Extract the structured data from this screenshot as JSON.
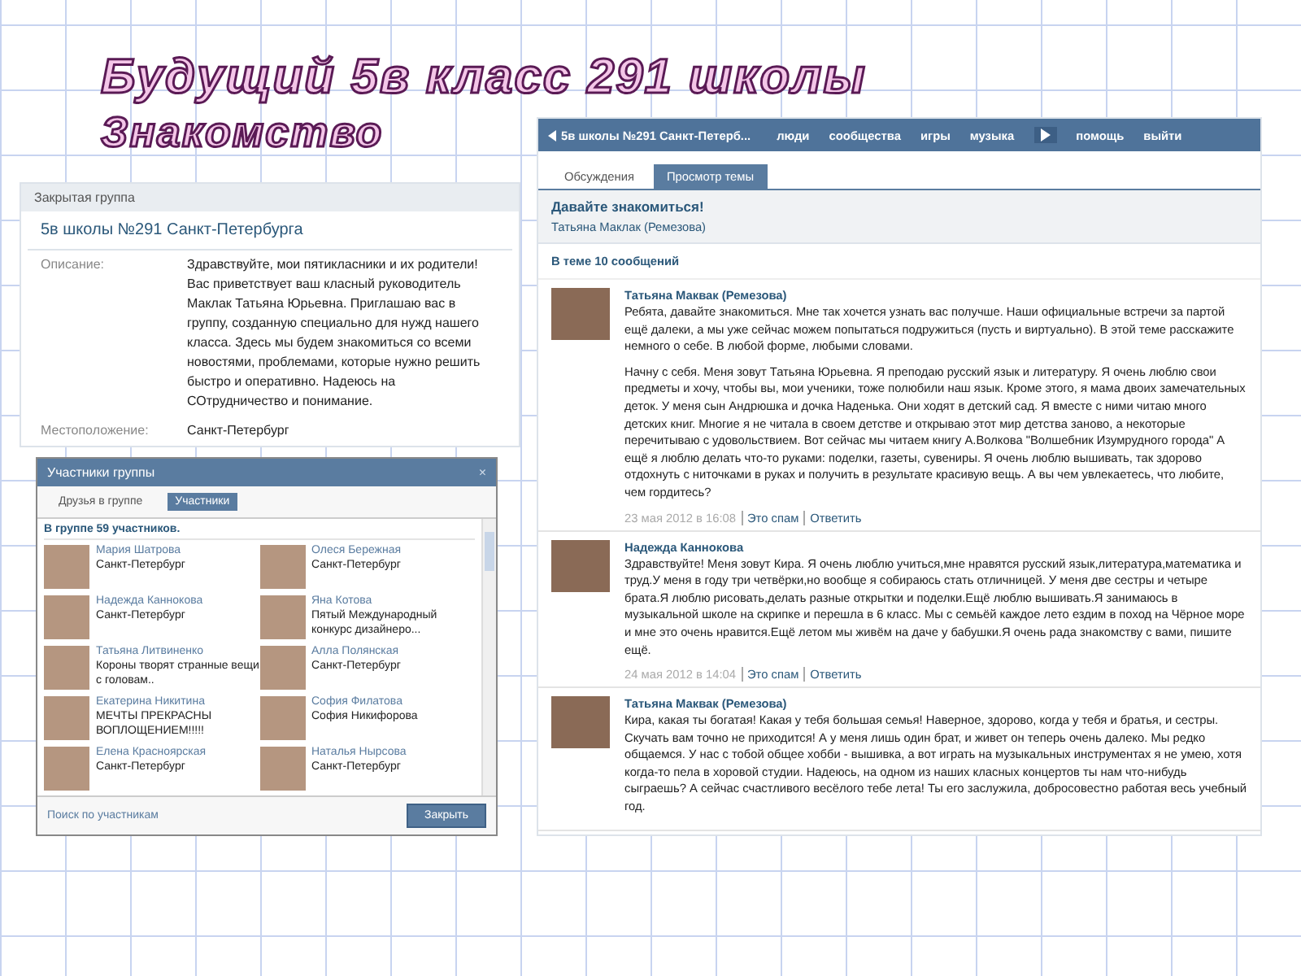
{
  "slide": {
    "title": "Будущий 5в класс 291 школы",
    "subtitle": "Знакомство"
  },
  "group_card": {
    "header": "Закрытая группа",
    "name": "5в школы №291 Санкт-Петербурга",
    "fields": [
      {
        "label": "Описание:",
        "value": "Здравствуйте, мои пятикласники и их родители! Вас приветствует ваш класный руководитель Маклак Татьяна Юрьевна. Приглашаю вас в группу, созданную специально для нужд нашего класса. Здесь мы будем знакомиться со всеми новостями, проблемами, которые нужно решить быстро и оперативно. Надеюсь на СОтрудничество и понимание."
      },
      {
        "label": "Местоположение:",
        "value": "Санкт-Петербург"
      }
    ]
  },
  "members_dialog": {
    "title": "Участники группы",
    "close": "×",
    "tabs": [
      {
        "label": "Друзья в группе",
        "selected": false
      },
      {
        "label": "Участники",
        "selected": true
      }
    ],
    "count": "В группе 59 участников.",
    "members": [
      {
        "name": "Мария Шатрова",
        "status": "Санкт-Петербург"
      },
      {
        "name": "Олеся Бережная",
        "status": "Санкт-Петербург"
      },
      {
        "name": "Надежда Каннокова",
        "status": "Санкт-Петербург"
      },
      {
        "name": "Яна Котова",
        "status": "Пятый Международный конкурс дизайнеро..."
      },
      {
        "name": "Татьяна Литвиненко",
        "status": "Короны творят странные вещи с головам.."
      },
      {
        "name": "Алла Полянская",
        "status": "Санкт-Петербург"
      },
      {
        "name": "Екатерина Никитина",
        "status": "МЕЧТЫ ПРЕКРАСНЫ ВОПЛОЩЕНИЕМ!!!!!"
      },
      {
        "name": "София Филатова",
        "status": "София Никифорова"
      },
      {
        "name": "Елена Красноярская",
        "status": "Санкт-Петербург"
      },
      {
        "name": "Наталья Нырсова",
        "status": "Санкт-Петербург"
      }
    ],
    "search_link": "Поиск по участникам",
    "close_button": "Закрыть"
  },
  "forum": {
    "nav": {
      "back": "5в школы №291 Санкт-Петерб...",
      "items": [
        "люди",
        "сообщества",
        "игры",
        "музыка"
      ],
      "items_after": [
        "помощь",
        "выйти"
      ]
    },
    "tabs": [
      {
        "label": "Обсуждения",
        "selected": false
      },
      {
        "label": "Просмотр темы",
        "selected": true
      }
    ],
    "topic": {
      "title": "Давайте знакомиться!",
      "author": "Татьяна Маклак (Ремезова)"
    },
    "count": "В теме 10 сообщений",
    "posts": [
      {
        "author": "Татьяна Маквак (Ремезова)",
        "paragraphs": [
          "Ребята, давайте знакомиться. Мне так хочется узнать вас получше. Наши официальные встречи за партой ещё далеки, а мы уже сейчас можем попытаться подружиться (пусть и виртуально). В этой теме расскажите немного о себе. В любой форме, любыми словами.",
          "Начну с себя. Меня зовут Татьяна Юрьевна. Я преподаю русский язык и литературу. Я очень люблю свои предметы и хочу, чтобы вы, мои ученики, тоже полюбили наш язык. Кроме этого, я мама двоих замечательных деток. У меня сын Андрюшка и дочка Наденька. Они ходят в детский сад. Я вместе с ними читаю много детских книг. Многие я не читала в своем детстве и открываю этот мир детства заново, а некоторые перечитываю с удовольствием. Вот сейчас мы читаем книгу А.Волкова \"Волшебник Изумрудного города\" А ещё я люблю делать что-то руками: поделки, газеты, сувениры. Я очень люблю вышивать, так здорово отдохнуть с ниточками в руках и получить в результате красивую вещь. А вы чем увлекаетесь, что любите, чем гордитесь?"
        ],
        "date": "23 мая 2012 в 16:08",
        "actions": [
          "Это спам",
          "Ответить"
        ]
      },
      {
        "author": "Надежда Каннокова",
        "paragraphs": [
          "Здравствуйте! Меня зовут Кира. Я очень люблю учиться,мне нравятся русский язык,литература,математика и труд.У меня в году три четвёрки,но вообще я собираюсь стать отличницей. У меня две сестры и четыре брата.Я люблю рисовать,делать разные открытки и поделки.Ещё люблю вышивать.Я занимаюсь в музыкальной школе на скрипке и перешла в 6 класс. Мы с семьёй каждое лето ездим в поход на Чёрное море и мне это очень нравится.Ещё летом мы живём на даче у бабушки.Я очень рада знакомству с вами, пишите ещё."
        ],
        "date": "24 мая 2012 в 14:04",
        "actions": [
          "Это спам",
          "Ответить"
        ]
      },
      {
        "author": "Татьяна Маквак (Ремезова)",
        "paragraphs": [
          "Кира, какая ты богатая! Какая у тебя большая семья! Наверное, здорово, когда у тебя и братья, и сестры. Скучать вам точно не приходится! А у меня лишь один брат, и живет он теперь очень далеко. Мы редко общаемся. У нас с тобой общее хобби - вышивка, а вот играть на музыкальных инструментах я не умею, хотя когда-то пела в хоровой студии. Надеюсь, на одном из наших класных концертов ты нам что-нибудь сыграешь? А сейчас счастливого весёлого тебе лета! Ты его заслужила, добросовестно работая весь учебный год."
        ]
      }
    ]
  }
}
